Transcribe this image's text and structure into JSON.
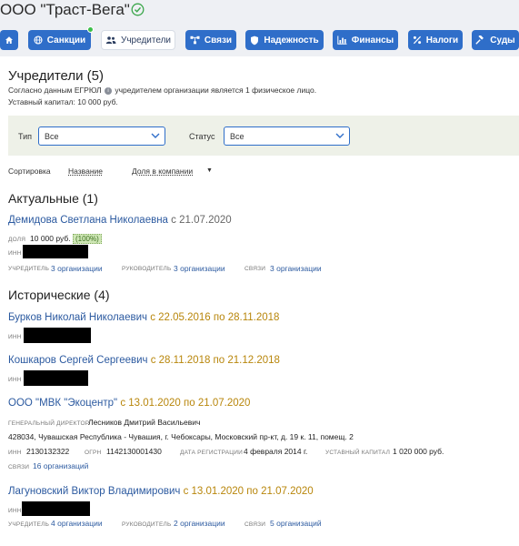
{
  "header": {
    "company_name": "ООО \"Траст-Вега\"",
    "verified_icon": "check-circle-icon"
  },
  "nav": [
    {
      "label": "",
      "icon": "home-icon"
    },
    {
      "label": "Санкции",
      "icon": "globe-icon",
      "has_notification": true
    },
    {
      "label": "Учредители",
      "icon": "users-icon",
      "active": true
    },
    {
      "label": "Связи",
      "icon": "network-icon"
    },
    {
      "label": "Надежность",
      "icon": "shield-icon"
    },
    {
      "label": "Финансы",
      "icon": "chart-icon"
    },
    {
      "label": "Налоги",
      "icon": "percent-icon"
    },
    {
      "label": "Суды",
      "icon": "gavel-icon"
    }
  ],
  "founders": {
    "title": "Учредители (5)",
    "note_before": "Согласно данным ЕГРЮЛ",
    "note_after": "учредителем организации является 1 физическое лицо.",
    "capital": "Уставный капитал: 10 000 руб."
  },
  "filters": {
    "type_label": "Тип",
    "type_value": "Все",
    "status_label": "Статус",
    "status_value": "Все"
  },
  "sort": {
    "label": "Сортировка",
    "options": [
      "Название",
      "Доля в компании"
    ]
  },
  "current": {
    "title": "Актуальные (1)",
    "items": [
      {
        "name": "Демидова Светлана Николаевна",
        "date": "с 21.07.2020",
        "share_label": "доля",
        "share_value": "10 000 руб.",
        "share_percent": "(100%)",
        "inn_label": "ИНН",
        "roles": [
          {
            "label": "учредитель",
            "link": "3 организации"
          },
          {
            "label": "руководитель",
            "link": "3 организации"
          },
          {
            "label": "связи",
            "link": "3 организации"
          }
        ]
      }
    ]
  },
  "historical": {
    "title": "Исторические (4)",
    "items": [
      {
        "name": "Бурков Николай Николаевич",
        "date": "с 22.05.2016 по 28.11.2018",
        "inn_label": "ИНН"
      },
      {
        "name": "Кошкаров Сергей Сергеевич",
        "date": "с 28.11.2018 по 21.12.2018",
        "inn_label": "ИНН"
      },
      {
        "name": "ООО \"МВК \"Экоцентр\"",
        "date": "с 13.01.2020 по 21.07.2020",
        "director_label": "генеральный директор",
        "director_name": "Лесников Дмитрий Васильевич",
        "address": "428034, Чувашская Республика - Чувашия, г. Чебоксары, Московский пр-кт, д. 19 к. 11, помещ. 2",
        "inn_label": "ИНН",
        "inn": "2130132322",
        "ogrn_label": "ОГРН",
        "ogrn": "1142130001430",
        "reg_label": "дата регистрации",
        "reg": "4 февраля 2014 г.",
        "cap_label": "уставный капитал",
        "cap": "1 020 000 руб.",
        "links_label": "связи",
        "links": "16 организаций"
      },
      {
        "name": "Лагуновский Виктор Владимирович",
        "date": "с 13.01.2020 по 21.07.2020",
        "inn_label": "ИНН",
        "roles": [
          {
            "label": "учредитель",
            "link": "4 организации"
          },
          {
            "label": "руководитель",
            "link": "2 организации"
          },
          {
            "label": "связи",
            "link": "5 организаций"
          }
        ]
      }
    ]
  },
  "colors": {
    "accent": "#2f6ec9",
    "link": "#2c5aa0",
    "historical_date": "#b8860b",
    "filter_bg": "#eef1e8"
  }
}
